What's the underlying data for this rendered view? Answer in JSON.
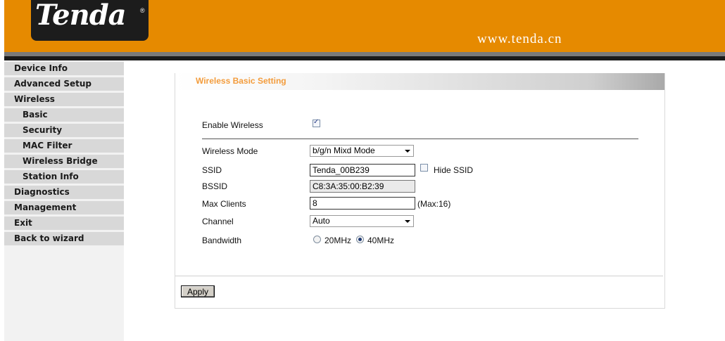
{
  "header": {
    "logo_text": "Tenda",
    "site_url": "www.tenda.cn",
    "brand_color": "#e68a00"
  },
  "nav": [
    {
      "label": "Device Info",
      "sub": false
    },
    {
      "label": "Advanced Setup",
      "sub": false
    },
    {
      "label": "Wireless",
      "sub": false
    },
    {
      "label": "Basic",
      "sub": true
    },
    {
      "label": "Security",
      "sub": true
    },
    {
      "label": "MAC Filter",
      "sub": true
    },
    {
      "label": "Wireless Bridge",
      "sub": true
    },
    {
      "label": "Station Info",
      "sub": true
    },
    {
      "label": "Diagnostics",
      "sub": false
    },
    {
      "label": "Management",
      "sub": false
    },
    {
      "label": "Exit",
      "sub": false
    },
    {
      "label": "Back to wizard",
      "sub": false
    }
  ],
  "panel": {
    "title": "Wireless Basic Setting",
    "enable_wireless_label": "Enable Wireless",
    "enable_wireless_checked": true,
    "wireless_mode_label": "Wireless Mode",
    "wireless_mode_value": "b/g/n Mixd Mode",
    "ssid_label": "SSID",
    "ssid_value": "Tenda_00B239",
    "hide_ssid_label": "Hide SSID",
    "hide_ssid_checked": false,
    "bssid_label": "BSSID",
    "bssid_value": "C8:3A:35:00:B2:39",
    "max_clients_label": "Max Clients",
    "max_clients_value": "8",
    "max_clients_hint": "(Max:16)",
    "channel_label": "Channel",
    "channel_value": "Auto",
    "bandwidth_label": "Bandwidth",
    "bandwidth_options": [
      "20MHz",
      "40MHz"
    ],
    "bandwidth_selected": "40MHz",
    "apply_label": "Apply"
  }
}
